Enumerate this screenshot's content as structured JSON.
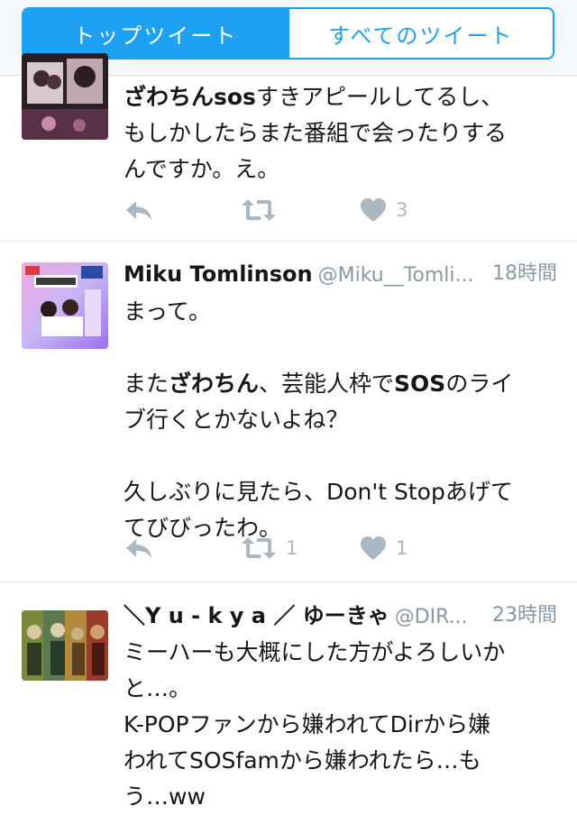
{
  "tabs": {
    "top": "トップツイート",
    "all": "すべてのツイート"
  },
  "tweets": [
    {
      "line1_bold": "ざわちんsos",
      "line1_rest": "すきアピールしてるし、",
      "line2": "もしかしたらまた番組で会ったりする",
      "line3": "んですか。え。",
      "reply_count": "",
      "retweet_count": "",
      "like_count": "3"
    },
    {
      "name": "Miku Tomlinson",
      "handle": "@Miku__Tomli...",
      "time": "18時間",
      "para1": "まって。",
      "line2_a": "また",
      "line2_b": "ざわちん",
      "line2_c": "、芸能人枠で",
      "line2_d": "SOS",
      "line2_e": "のライ",
      "line3": "ブ行くとかないよね？",
      "line4": "久しぶりに見たら、Don't Stopあげて",
      "line5": "てびびったわ。",
      "retweet_count": "1",
      "like_count": "1"
    },
    {
      "name": "＼Y u - k y a ／ ゆーきゃ",
      "handle": "@DIR...",
      "time": "23時間",
      "line1": "ミーハーも大概にした方がよろしいか",
      "line2": "と…。",
      "line3": "K-POPファンから嫌われてDirから嫌",
      "line4": "われてSOSfamから嫌われたら…も",
      "line5": "う…ww"
    }
  ],
  "colors": {
    "accent": "#1da1f2",
    "muted": "#8899a6",
    "icon": "#aab8c2"
  }
}
